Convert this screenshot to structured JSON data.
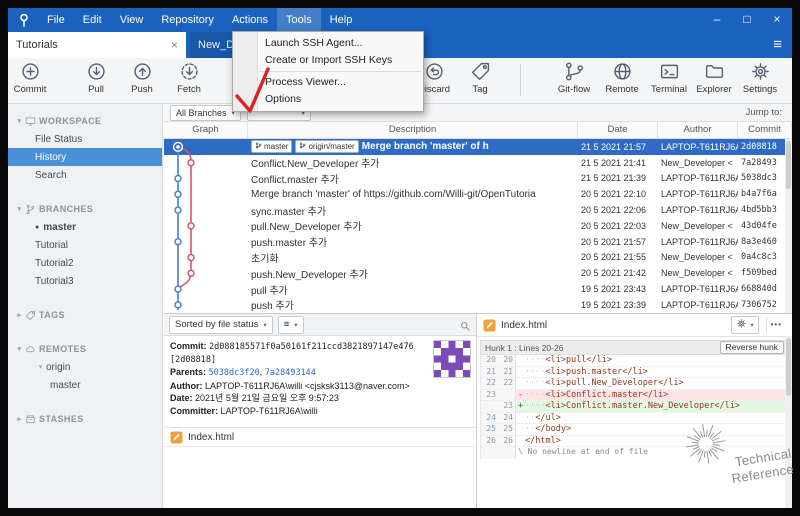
{
  "colors": {
    "titlebar": "#1a62bd",
    "selection": "#2e6bc5",
    "sidebar_selected": "#4a90d9",
    "graph_blue": "#4a7fd4",
    "graph_red": "#d4566d",
    "added_bg": "#e4f6e4",
    "removed_bg": "#ffe4e7",
    "file_icon_orange": "#f0a13a",
    "avatar_purple": "#7d4bb5",
    "annotation_red": "#dd2222"
  },
  "icons": {
    "caret": "▾",
    "close_tab": "×",
    "more": "•••",
    "list_menu": "≡"
  },
  "window": {
    "menus": [
      "File",
      "Edit",
      "View",
      "Repository",
      "Actions",
      "Tools",
      "Help"
    ],
    "active_menu": "Tools",
    "controls": {
      "minimize": "–",
      "maximize": "□",
      "close": "×"
    },
    "hamburger": "≡"
  },
  "tabs": {
    "active": "Tutorials",
    "inactive": "New_D"
  },
  "tools_menu": [
    {
      "label": "Launch SSH Agent..."
    },
    {
      "label": "Create or Import SSH Keys"
    },
    {
      "label": "Process Viewer...",
      "sep_before": true
    },
    {
      "label": "Options"
    }
  ],
  "toolbar": [
    {
      "label": "Commit",
      "icon": "commit"
    },
    {
      "label": "Pull",
      "icon": "pull"
    },
    {
      "label": "Push",
      "icon": "push"
    },
    {
      "label": "Fetch",
      "icon": "fetch"
    },
    {
      "label": "Discard",
      "icon": "discard"
    },
    {
      "label": "Tag",
      "icon": "tag"
    },
    {
      "label": "Git-flow",
      "icon": "gitflow"
    },
    {
      "label": "Remote",
      "icon": "remote"
    },
    {
      "label": "Terminal",
      "icon": "terminal"
    },
    {
      "label": "Explorer",
      "icon": "explorer"
    },
    {
      "label": "Settings",
      "icon": "settings"
    }
  ],
  "sidebar": [
    {
      "type": "section",
      "label": "WORKSPACE",
      "icon": "monitor",
      "chevron": "▾"
    },
    {
      "type": "item",
      "label": "File Status",
      "indent": 1
    },
    {
      "type": "item",
      "label": "History",
      "indent": 1,
      "selected": true
    },
    {
      "type": "item",
      "label": "Search",
      "indent": 1
    },
    {
      "type": "section",
      "label": "BRANCHES",
      "icon": "branch",
      "chevron": "▾"
    },
    {
      "type": "item",
      "label": "master",
      "indent": 1,
      "bullet": true,
      "bold": true
    },
    {
      "type": "item",
      "label": "Tutorial",
      "indent": 1
    },
    {
      "type": "item",
      "label": "Tutorial2",
      "indent": 1
    },
    {
      "type": "item",
      "label": "Tutorial3",
      "indent": 1
    },
    {
      "type": "section",
      "label": "TAGS",
      "icon": "tag",
      "chevron": "▸"
    },
    {
      "type": "section",
      "label": "REMOTES",
      "icon": "cloud",
      "chevron": "▾"
    },
    {
      "type": "item",
      "label": "origin",
      "indent": 1,
      "chevron": "▾"
    },
    {
      "type": "item",
      "label": "master",
      "indent": 2
    },
    {
      "type": "section",
      "label": "STASHES",
      "icon": "box",
      "chevron": "▸"
    }
  ],
  "history": {
    "branch_filter": "All Branches",
    "jump_to": "Jump to:",
    "columns": [
      "Graph",
      "Description",
      "Date",
      "Author",
      "Commit"
    ],
    "rows": [
      {
        "badges": [
          "master",
          "origin/master"
        ],
        "description": "Merge branch 'master' of h",
        "date": "21 5 2021 21:57",
        "author": "LAPTOP-T611RJ6A",
        "commit": "2d08818",
        "selected": true,
        "lane": 0
      },
      {
        "description": "Conflict.New_Developer 추가",
        "date": "21 5 2021 21:41",
        "author": "New_Developer <",
        "commit": "7a28493",
        "lane": 1
      },
      {
        "description": "Conflict.master 추가",
        "date": "21 5 2021 21:39",
        "author": "LAPTOP-T611RJ6A",
        "commit": "5038dc3",
        "lane": 0
      },
      {
        "description": "Merge branch 'master' of https://github.com/Willi-git/OpenTutoria",
        "date": "20 5 2021 22:10",
        "author": "LAPTOP-T611RJ6A",
        "commit": "b4a7f6a",
        "lane": 0
      },
      {
        "description": "sync.master 추가",
        "date": "20 5 2021 22:06",
        "author": "LAPTOP-T611RJ6A",
        "commit": "4bd5bb3",
        "lane": 0
      },
      {
        "description": "pull.New_Developer 추가",
        "date": "20 5 2021 22:03",
        "author": "New_Developer <",
        "commit": "43d04fe",
        "lane": 1
      },
      {
        "description": "push.master 추가",
        "date": "20 5 2021 21:57",
        "author": "LAPTOP-T611RJ6A",
        "commit": "8a3e460",
        "lane": 0
      },
      {
        "description": "초기화",
        "date": "20 5 2021 21:55",
        "author": "New_Developer <",
        "commit": "0a4c8c3",
        "lane": 1
      },
      {
        "description": "push.New_Developer 추가",
        "date": "20 5 2021 21:42",
        "author": "New_Developer <",
        "commit": "f509bed",
        "lane": 1
      },
      {
        "description": "pull 추가",
        "date": "19 5 2021 23:43",
        "author": "LAPTOP-T611RJ6A",
        "commit": "668840d",
        "lane": 0
      },
      {
        "description": "push 추가",
        "date": "19 5 2021 23:39",
        "author": "LAPTOP-T611RJ6A",
        "commit": "7306752",
        "lane": 0
      }
    ]
  },
  "file_panel": {
    "sort_dropdown": "Sorted by file status",
    "files": [
      {
        "name": "Index.html"
      }
    ]
  },
  "commit_info": {
    "commit_label": "Commit:",
    "commit_hash": "2d088185571f0a50161f211ccd3821897147e476",
    "commit_short": "[2d08818]",
    "parents_label": "Parents:",
    "parents": [
      "5038dc3f20",
      "7a28493144"
    ],
    "author_label": "Author:",
    "author": "LAPTOP-T611RJ6A\\willi <cjsksk3113@naver.com>",
    "date_label": "Date:",
    "date": "2021년 5월 21일 금요일 오후 9:57:23",
    "committer_label": "Committer:",
    "committer": "LAPTOP-T611RJ6A\\willi"
  },
  "diff_panel": {
    "file": "Index.html",
    "hunk_header": "Hunk 1 : Lines 20-26",
    "reverse_button": "Reverse hunk",
    "lines": [
      {
        "old": "20",
        "new": "20",
        "type": "ctx",
        "indent": 4,
        "code": "<li>pull</li>"
      },
      {
        "old": "21",
        "new": "21",
        "type": "ctx",
        "indent": 4,
        "code": "<li>push.master</li>"
      },
      {
        "old": "22",
        "new": "22",
        "type": "ctx",
        "indent": 4,
        "code": "<li>pull.New_Developer</li>"
      },
      {
        "old": "23",
        "new": "",
        "type": "del",
        "indent": 4,
        "code": "<li>Conflict.master</li>"
      },
      {
        "old": "",
        "new": "23",
        "type": "add",
        "indent": 4,
        "code": "<li>Conflict.master.New_Developer</li>"
      },
      {
        "old": "24",
        "new": "24",
        "type": "ctx",
        "indent": 2,
        "code": "</ul>"
      },
      {
        "old": "25",
        "new": "25",
        "type": "ctx",
        "indent": 2,
        "code": "</body>"
      },
      {
        "old": "26",
        "new": "26",
        "type": "ctx",
        "indent": 0,
        "code": "</html>"
      },
      {
        "old": "",
        "new": "",
        "type": "meta",
        "indent": 0,
        "code": "\\ No newline at end of file"
      }
    ]
  },
  "watermark": {
    "line1": "Technical",
    "line2": "Reference"
  }
}
